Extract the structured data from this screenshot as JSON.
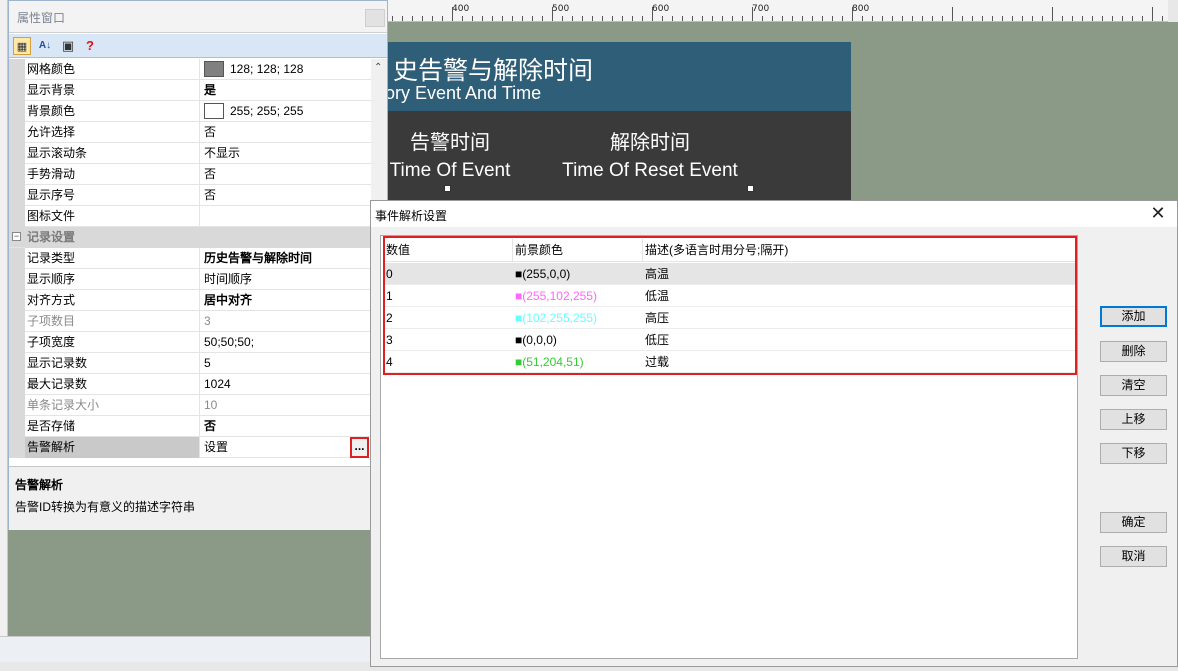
{
  "ruler": {
    "labels": [
      "400",
      "500",
      "600",
      "700",
      "800"
    ]
  },
  "canvas_widget": {
    "title_cn": "史告警与解除时间",
    "title_en": "ory Event And Time",
    "columns": [
      {
        "cn": "告警时间",
        "en": "Time Of Event"
      },
      {
        "cn": "解除时间",
        "en": "Time Of Reset Event"
      }
    ],
    "colors": {
      "title_bar": "#2e5e78",
      "body": "#3a3a3a"
    }
  },
  "property_window": {
    "title": "属性窗口",
    "toolbar": {
      "help_glyph": "?"
    },
    "rows": [
      {
        "name": "网格颜色",
        "value": "128; 128; 128",
        "swatch": "#808080"
      },
      {
        "name": "显示背景",
        "value": "是",
        "bold": true
      },
      {
        "name": "背景颜色",
        "value": "255; 255; 255",
        "swatch": "#ffffff"
      },
      {
        "name": "允许选择",
        "value": "否"
      },
      {
        "name": "显示滚动条",
        "value": "不显示"
      },
      {
        "name": "手势滑动",
        "value": "否"
      },
      {
        "name": "显示序号",
        "value": "否"
      },
      {
        "name": "图标文件",
        "value": ""
      },
      {
        "category": true,
        "name": "记录设置",
        "toggle": "−"
      },
      {
        "name": "记录类型",
        "value": "历史告警与解除时间",
        "bold": true
      },
      {
        "name": "显示顺序",
        "value": "时间顺序"
      },
      {
        "name": "对齐方式",
        "value": "居中对齐",
        "bold": true
      },
      {
        "name": "子项数目",
        "value": "3",
        "disabled": true
      },
      {
        "name": "子项宽度",
        "value": "50;50;50;"
      },
      {
        "name": "显示记录数",
        "value": "5"
      },
      {
        "name": "最大记录数",
        "value": "1024"
      },
      {
        "name": "单条记录大小",
        "value": "10",
        "disabled": true
      },
      {
        "name": "是否存储",
        "value": "否",
        "bold": true
      },
      {
        "name": "告警解析",
        "value": "设置",
        "selected": true,
        "ellipsis": "..."
      }
    ],
    "description": {
      "title": "告警解析",
      "text": "告警ID转换为有意义的描述字符串"
    }
  },
  "event_dialog": {
    "title": "事件解析设置",
    "close_glyph": "✕",
    "columns": [
      "数值",
      "前景颜色",
      "描述(多语言时用分号;隔开)"
    ],
    "rows": [
      {
        "value": "0",
        "color_label": "■(255,0,0)",
        "color": "#000000",
        "description": "高温"
      },
      {
        "value": "1",
        "color_label": "■(255,102,255)",
        "color": "#ff66ff",
        "description": "低温"
      },
      {
        "value": "2",
        "color_label": "■(102,255,255)",
        "color": "#66ffff",
        "description": "高压"
      },
      {
        "value": "3",
        "color_label": "■(0,0,0)",
        "color": "#000000",
        "description": "低压"
      },
      {
        "value": "4",
        "color_label": "■(51,204,51)",
        "color": "#33cc33",
        "description": "过载"
      }
    ],
    "buttons": {
      "add": "添加",
      "delete": "删除",
      "clear": "清空",
      "move_up": "上移",
      "move_down": "下移",
      "ok": "确定",
      "cancel": "取消"
    },
    "highlight_color": "#e02020"
  }
}
